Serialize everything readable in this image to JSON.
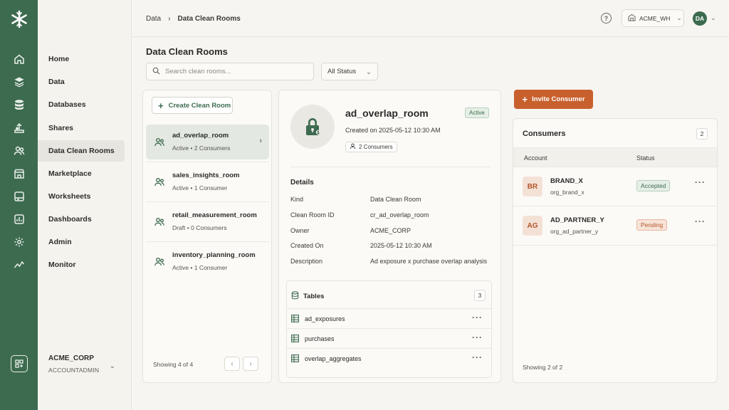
{
  "breadcrumb": {
    "parent": "Data",
    "current": "Data Clean Rooms"
  },
  "topbar": {
    "warehouse": "ACME_WH",
    "avatar_initials": "DA"
  },
  "nav": {
    "items": [
      {
        "label": "Home",
        "icon": "home-icon"
      },
      {
        "label": "Data",
        "icon": "layers-icon"
      },
      {
        "label": "Databases",
        "icon": "database-icon"
      },
      {
        "label": "Shares",
        "icon": "share-icon"
      },
      {
        "label": "Data Clean Rooms",
        "icon": "users-icon",
        "active": true
      },
      {
        "label": "Marketplace",
        "icon": "store-icon"
      },
      {
        "label": "Worksheets",
        "icon": "worksheet-icon"
      },
      {
        "label": "Dashboards",
        "icon": "dashboard-icon"
      },
      {
        "label": "Admin",
        "icon": "gear-icon"
      },
      {
        "label": "Monitor",
        "icon": "activity-icon"
      }
    ],
    "account": {
      "name": "ACME_CORP",
      "role": "ACCOUNTADMIN"
    }
  },
  "page": {
    "title": "Data Clean Rooms",
    "search_placeholder": "Search clean rooms...",
    "status_filter": "All Status"
  },
  "list": {
    "create_label": "Create Clean Room",
    "rooms": [
      {
        "name": "ad_overlap_room",
        "meta": "Active  •  2 Consumers",
        "selected": true
      },
      {
        "name": "sales_insights_room",
        "meta": "Active  •  1 Consumer"
      },
      {
        "name": "retail_measurement_room",
        "meta": "Draft  •  0 Consumers"
      },
      {
        "name": "inventory_planning_room",
        "meta": "Active  •  1 Consumer"
      }
    ],
    "showing": "Showing 4 of 4"
  },
  "detail": {
    "name": "ad_overlap_room",
    "status": "Active",
    "created": "Created on 2025-05-12 10:30 AM",
    "consumers_chip": "2 Consumers",
    "details_heading": "Details",
    "fields": [
      {
        "key": "Kind",
        "value": "Data Clean Room"
      },
      {
        "key": "Clean Room ID",
        "value": "cr_ad_overlap_room"
      },
      {
        "key": "Owner",
        "value": "ACME_CORP"
      },
      {
        "key": "Created On",
        "value": "2025-05-12 10:30 AM"
      },
      {
        "key": "Description",
        "value": "Ad exposure x purchase overlap analysis"
      }
    ],
    "tables_heading": "Tables",
    "tables_count": "3",
    "tables": [
      "ad_exposures",
      "purchases",
      "overlap_aggregates"
    ]
  },
  "consumers": {
    "invite_label": "Invite Consumer",
    "title": "Consumers",
    "count": "2",
    "col_account": "Account",
    "col_status": "Status",
    "rows": [
      {
        "initials": "BR",
        "name": "BRAND_X",
        "org": "org_brand_x",
        "status": "Accepted"
      },
      {
        "initials": "AG",
        "name": "AD_PARTNER_Y",
        "org": "org_ad_partner_y",
        "status": "Pending"
      }
    ],
    "showing": "Showing 2 of 2"
  },
  "colors": {
    "brand": "#3d6b4f",
    "accent": "#c8602e",
    "background": "#f7f5f1"
  }
}
